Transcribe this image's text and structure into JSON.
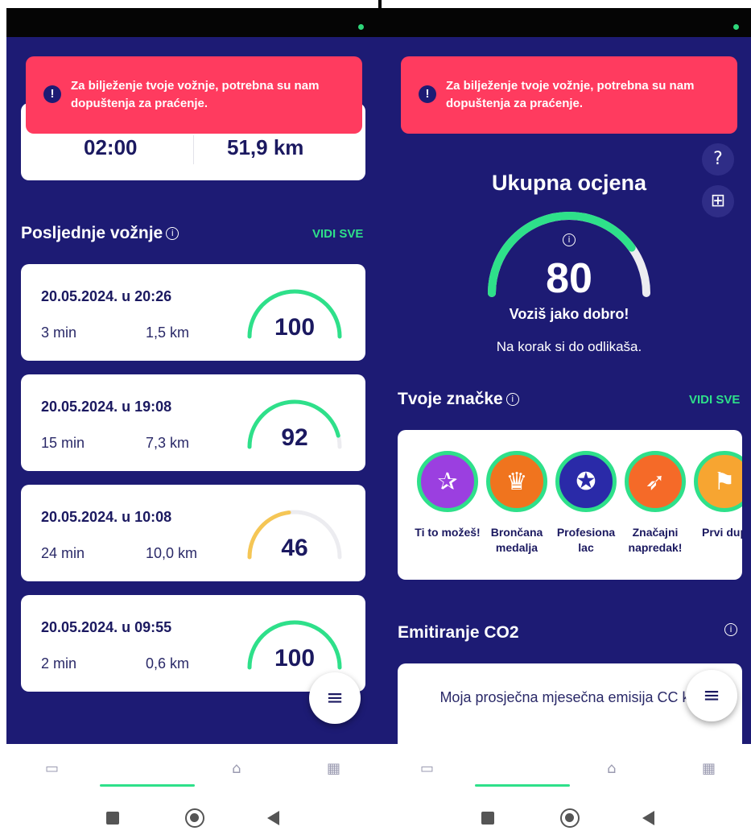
{
  "colors": {
    "background": "#1d1b74",
    "alert": "#ff3b5f",
    "accent_green": "#2ee08a",
    "gauge_yellow": "#f5c655",
    "gauge_track": "#ececf0"
  },
  "left": {
    "alert_text": "Za bilježenje tvoje vožnje, potrebna su nam dopuštenja za praćenje.",
    "summary": {
      "time": "02:00",
      "distance": "51,9 km"
    },
    "section_title": "Posljednje vožnje",
    "see_all": "VIDI SVE",
    "rides": [
      {
        "date": "20.05.2024. u 20:26",
        "duration": "3 min",
        "distance": "1,5 km",
        "score": "100",
        "score_fraction": 1.0,
        "color": "#2ee08a"
      },
      {
        "date": "20.05.2024. u 19:08",
        "duration": "15 min",
        "distance": "7,3 km",
        "score": "92",
        "score_fraction": 0.92,
        "color": "#2ee08a"
      },
      {
        "date": "20.05.2024. u 10:08",
        "duration": "24 min",
        "distance": "10,0 km",
        "score": "46",
        "score_fraction": 0.46,
        "color": "#f5c655"
      },
      {
        "date": "20.05.2024. u 09:55",
        "duration": "2 min",
        "distance": "0,6 km",
        "score": "100",
        "score_fraction": 1.0,
        "color": "#2ee08a"
      }
    ]
  },
  "right": {
    "alert_text": "Za bilježenje tvoje vožnje, potrebna su nam dopuštenja za praćenje.",
    "score_title": "Ukupna ocjena",
    "score": "80",
    "score_fraction": 0.8,
    "score_message": "Voziš jako dobro!",
    "score_sub": "Na korak si do odlikaša.",
    "badges_title": "Tvoje značke",
    "see_all": "VIDI SVE",
    "badges": [
      {
        "label": "Ti to možeš!",
        "color": "#9b3fe0",
        "icon": "stars-icon"
      },
      {
        "label": "Brončana medalja",
        "color": "#f0741e",
        "icon": "trophy-icon"
      },
      {
        "label": "Profesiona lac",
        "color": "#2a2aa8",
        "icon": "medal-icon"
      },
      {
        "label": "Značajni napredak!",
        "color": "#f56a28",
        "icon": "rocket-icon"
      },
      {
        "label": "Prvi dup",
        "color": "#f7a531",
        "icon": "flags-icon"
      }
    ],
    "co2_title": "Emitiranje CO2",
    "co2_text": "Moja prosječna mjesečna emisija CC km"
  }
}
